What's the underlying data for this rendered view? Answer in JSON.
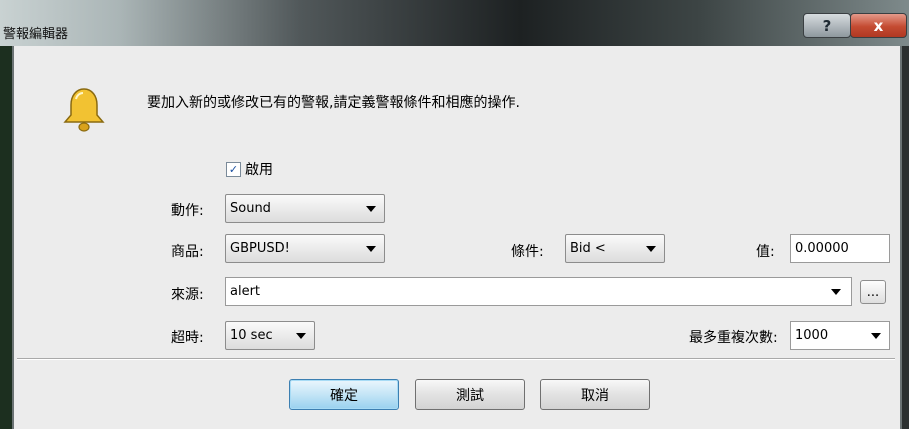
{
  "window": {
    "title": "警報編輯器",
    "help_glyph": "?",
    "close_glyph": "x"
  },
  "description": "要加入新的或修改已有的警報,請定義警報條件和相應的操作.",
  "enable": {
    "label": "啟用",
    "checked": true,
    "check_glyph": "✓"
  },
  "action": {
    "label": "動作:",
    "value": "Sound"
  },
  "symbol": {
    "label": "商品:",
    "value": "GBPUSD!"
  },
  "condition": {
    "label": "條件:",
    "value": "Bid <"
  },
  "threshold": {
    "label": "值:",
    "value": "0.00000"
  },
  "source": {
    "label": "來源:",
    "value": "alert",
    "browse_label": "..."
  },
  "timeout": {
    "label": "超時:",
    "value": "10 sec"
  },
  "max_iterations": {
    "label": "最多重複次數:",
    "value": "1000"
  },
  "buttons": {
    "ok": "確定",
    "test": "測試",
    "cancel": "取消"
  },
  "icons": {
    "dialog_icon": "bell-icon",
    "dropdown": "triangle-down-icon"
  },
  "colors": {
    "bell": "#f2c232",
    "primary_button": "#98d1ef",
    "close_button": "#c44b32"
  }
}
